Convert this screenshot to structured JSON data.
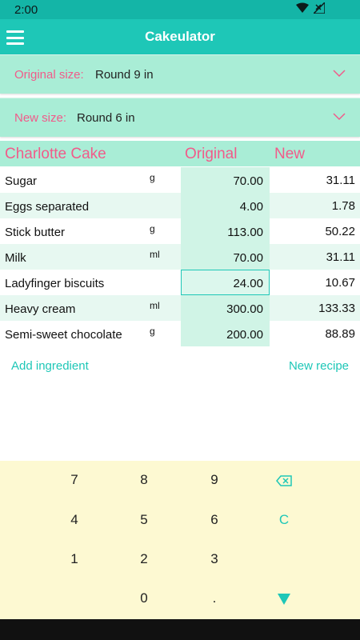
{
  "status": {
    "time": "2:00"
  },
  "app": {
    "title": "Cakeulator"
  },
  "original_size": {
    "label": "Original size:",
    "value": "Round 9 in"
  },
  "new_size": {
    "label": "New size:",
    "value": "Round 6 in"
  },
  "table": {
    "headers": {
      "recipe": "Charlotte Cake",
      "original": "Original",
      "new": "New"
    },
    "rows": [
      {
        "name": "Sugar",
        "unit": "g",
        "original": "70.00",
        "new": "31.11"
      },
      {
        "name": "Eggs separated",
        "unit": "",
        "original": "4.00",
        "new": "1.78"
      },
      {
        "name": "Stick butter",
        "unit": "g",
        "original": "113.00",
        "new": "50.22"
      },
      {
        "name": "Milk",
        "unit": "ml",
        "original": "70.00",
        "new": "31.11"
      },
      {
        "name": "Ladyfinger biscuits",
        "unit": "",
        "original": "24.00",
        "new": "10.67"
      },
      {
        "name": "Heavy cream",
        "unit": "ml",
        "original": "300.00",
        "new": "133.33"
      },
      {
        "name": "Semi-sweet chocolate",
        "unit": "g",
        "original": "200.00",
        "new": "88.89"
      }
    ]
  },
  "actions": {
    "add_ingredient": "Add ingredient",
    "new_recipe": "New recipe"
  },
  "keypad": {
    "row1": [
      "7",
      "8",
      "9"
    ],
    "row2": [
      "4",
      "5",
      "6"
    ],
    "clear": "C",
    "row3": [
      "1",
      "2",
      "3"
    ],
    "row4": [
      "0",
      "."
    ]
  },
  "colors": {
    "accent": "#1ec7b7",
    "pink": "#f15b8a",
    "mint": "#a9edd6",
    "keypad": "#fdf9d2"
  }
}
